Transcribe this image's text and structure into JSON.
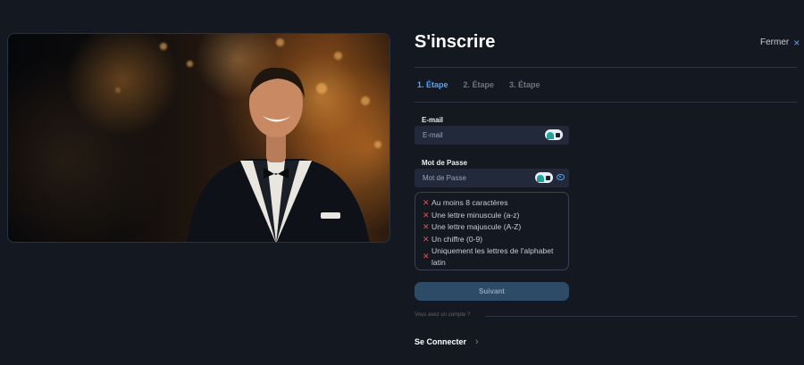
{
  "header": {
    "title": "S'inscrire",
    "close_label": "Fermer"
  },
  "steps": [
    {
      "label": "1. Étape",
      "active": true
    },
    {
      "label": "2. Étape",
      "active": false
    },
    {
      "label": "3. Étape",
      "active": false
    }
  ],
  "form": {
    "email_label": "E-mail",
    "email_placeholder": "E-mail",
    "password_label": "Mot de Passe",
    "password_placeholder": "Mot de Passe",
    "rules": [
      "Au moins 8 caractères",
      "Une lettre minuscule (a-z)",
      "Une lettre majuscule (A-Z)",
      "Un chiffre (0-9)",
      "Uniquement les lettres de l'alphabet latin"
    ],
    "submit_label": "Suivant"
  },
  "footer": {
    "account_prompt": "Vous avez un compte ?",
    "login_label": "Se Connecter"
  },
  "icons": {
    "close": "close-icon",
    "rule_fail": "x-mark-icon",
    "password_toggle": "eye-icon",
    "autofill": "autofill-lock-icon",
    "login_chevron": "chevron-right-icon"
  },
  "colors": {
    "accent": "#4ea7ff",
    "error": "#e05252",
    "background": "#141821",
    "input_bg": "#22293b",
    "button_bg": "#2d4a66"
  }
}
